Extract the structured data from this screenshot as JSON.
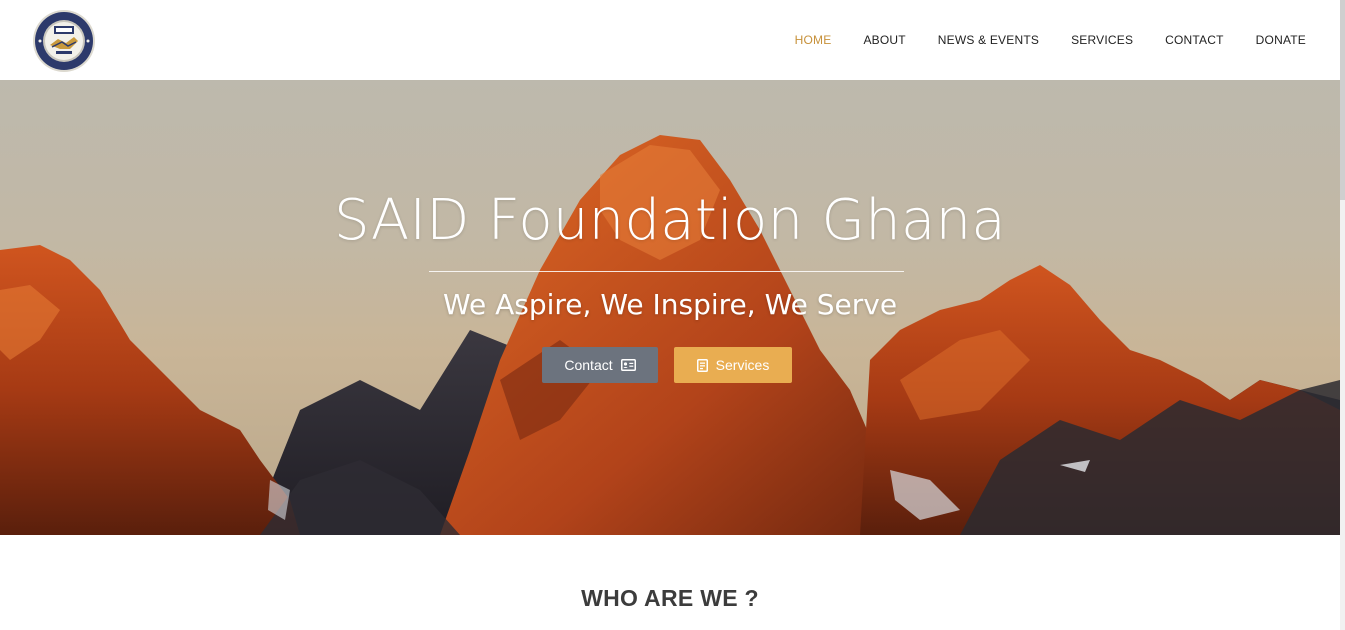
{
  "header": {
    "logo": {
      "icon": "said-seal-logo",
      "text_top": "ADVOCATE · SAID",
      "text_center": "SAID",
      "text_bottom": "WE INSPIRE"
    },
    "nav": [
      {
        "label": "HOME",
        "active": true
      },
      {
        "label": "ABOUT",
        "active": false
      },
      {
        "label": "NEWS & EVENTS",
        "active": false
      },
      {
        "label": "SERVICES",
        "active": false
      },
      {
        "label": "CONTACT",
        "active": false
      },
      {
        "label": "DONATE",
        "active": false
      }
    ]
  },
  "hero": {
    "title": "SAID Foundation Ghana",
    "subtitle": "We Aspire, We Inspire, We Serve",
    "buttons": {
      "contact": {
        "label": "Contact",
        "icon": "contact-card-icon"
      },
      "services": {
        "label": "Services",
        "icon": "document-icon"
      }
    }
  },
  "section": {
    "title": "WHO ARE WE ?"
  },
  "colors": {
    "accent": "#c7913a",
    "contact_button": "#6c737e",
    "services_button": "#e9ad51",
    "nav_text": "#222222"
  }
}
